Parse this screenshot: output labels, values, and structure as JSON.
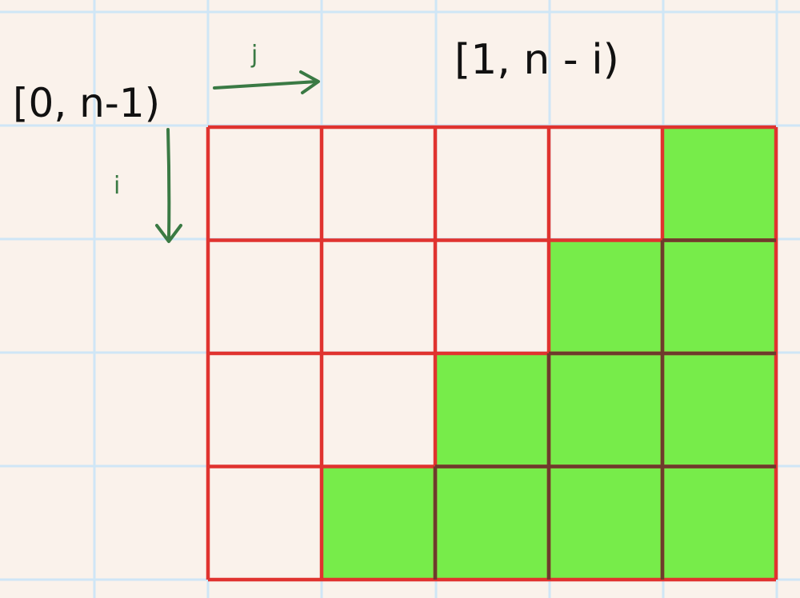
{
  "colors": {
    "paper": "#faf2eb",
    "paper_grid": "#cfe6f6",
    "matrix_border": "#e0332f",
    "filled_cell": "#77ec4a",
    "filled_cell_border": "#6e3a2c",
    "annotation_green": "#3a7a44",
    "ink": "#111111"
  },
  "labels": {
    "row_range": "[0, n-1)",
    "col_range": "[1, n - i)",
    "col_index": "j",
    "row_index": "i"
  },
  "matrix": {
    "rows": 4,
    "cols": 5,
    "filled": [
      [
        0,
        0,
        0,
        0,
        1
      ],
      [
        0,
        0,
        0,
        1,
        1
      ],
      [
        0,
        0,
        1,
        1,
        1
      ],
      [
        0,
        1,
        1,
        1,
        1
      ]
    ]
  }
}
